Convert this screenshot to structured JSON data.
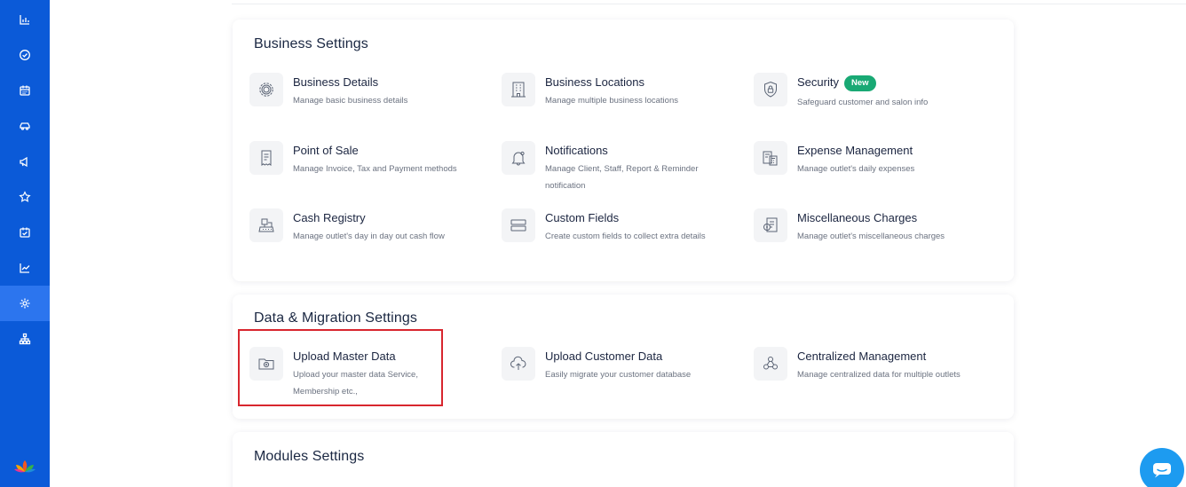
{
  "sidebar": {
    "items": [
      {
        "icon": "bar-chart-icon"
      },
      {
        "icon": "check-circle-icon"
      },
      {
        "icon": "calendar-icon"
      },
      {
        "icon": "car-icon"
      },
      {
        "icon": "megaphone-icon"
      },
      {
        "icon": "star-icon"
      },
      {
        "icon": "calendar-check-icon"
      },
      {
        "icon": "trend-chart-icon"
      },
      {
        "icon": "gear-icon",
        "active": true
      },
      {
        "icon": "org-chart-icon"
      }
    ],
    "logo": "lotus-logo"
  },
  "business_settings": {
    "title": "Business Settings",
    "items": [
      {
        "title": "Business Details",
        "desc": "Manage basic business details",
        "icon": "gear-circle-icon"
      },
      {
        "title": "Business Locations",
        "desc": "Manage multiple business locations",
        "icon": "building-icon"
      },
      {
        "title": "Security",
        "badge": "New",
        "desc": "Safeguard customer and salon info",
        "icon": "shield-lock-icon"
      },
      {
        "title": "Point of Sale",
        "desc": "Manage Invoice, Tax and Payment methods",
        "icon": "receipt-icon"
      },
      {
        "title": "Notifications",
        "desc": "Manage Client, Staff, Report & Reminder notification",
        "icon": "bell-icon"
      },
      {
        "title": "Expense Management",
        "desc": "Manage outlet's daily expenses",
        "icon": "calculator-icon"
      },
      {
        "title": "Cash Registry",
        "desc": "Manage outlet's day in day out cash flow",
        "icon": "cash-register-icon"
      },
      {
        "title": "Custom Fields",
        "desc": "Create custom fields to collect extra details",
        "icon": "fields-icon"
      },
      {
        "title": "Miscellaneous Charges",
        "desc": "Manage outlet's miscellaneous charges",
        "icon": "charges-icon"
      }
    ]
  },
  "data_migration_settings": {
    "title": "Data & Migration Settings",
    "items": [
      {
        "title": "Upload Master Data",
        "desc": "Upload your master data Service, Membership etc.,",
        "icon": "folder-upload-icon"
      },
      {
        "title": "Upload Customer Data",
        "desc": "Easily migrate your customer database",
        "icon": "cloud-upload-icon"
      },
      {
        "title": "Centralized Management",
        "desc": "Manage centralized data for multiple outlets",
        "icon": "network-icon"
      }
    ]
  },
  "modules_settings": {
    "title": "Modules Settings"
  },
  "chat": {
    "icon": "chat-icon"
  },
  "colors": {
    "sidebar": "#0b5ad8",
    "badge": "#19a974",
    "highlight": "#d8262e",
    "chat": "#1d9bf0"
  }
}
